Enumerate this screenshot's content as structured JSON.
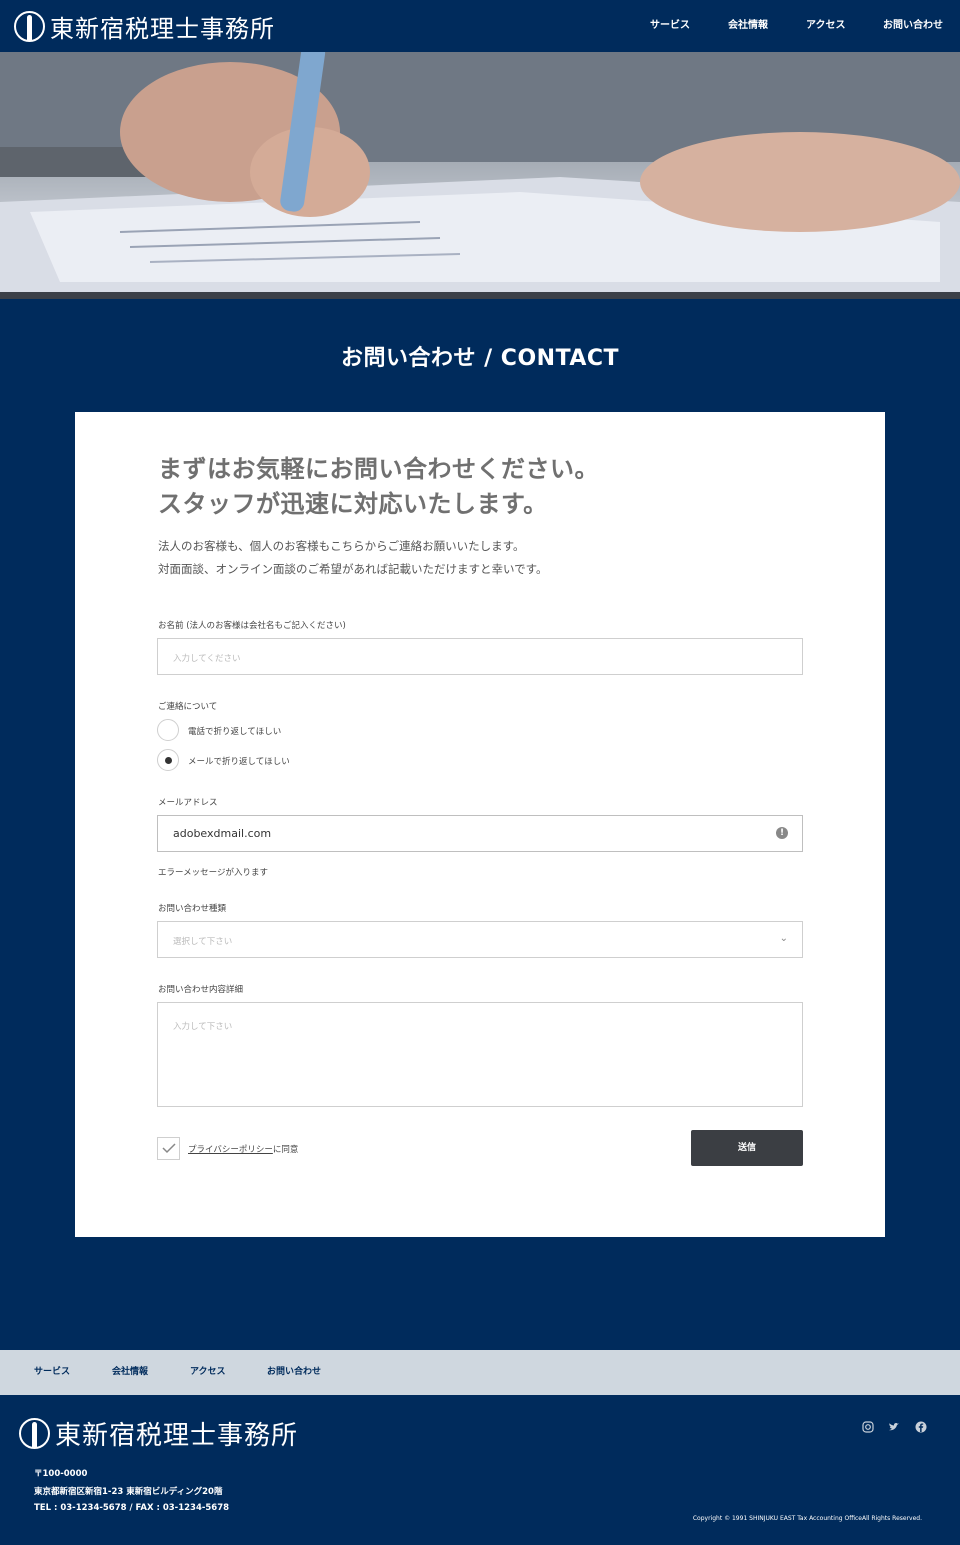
{
  "header": {
    "logo_text": "東新宿税理士事務所",
    "nav": [
      "サービス",
      "会社情報",
      "アクセス",
      "お問い合わせ"
    ]
  },
  "section_title": "お問い合わせ / CONTACT",
  "form": {
    "lead_line1": "まずはお気軽にお問い合わせください。",
    "lead_line2": "スタッフが迅速に対応いたします。",
    "desc_line1": "法人のお客様も、個人のお客様もこちらからご連絡お願いいたします。",
    "desc_line2": "対面面談、オンライン面談のご希望があれば記載いただけますと幸いです。",
    "name_label": "お名前 (法人のお客様は会社名もご記入ください)",
    "name_placeholder": "入力してください",
    "contact_label": "ご連絡について",
    "radio_phone": "電話で折り返してほしい",
    "radio_mail": "メールで折り返してほしい",
    "email_label": "メールアドレス",
    "email_value": "adobexdmail.com",
    "email_error": "エラーメッセージが入ります",
    "type_label": "お問い合わせ種類",
    "type_placeholder": "選択して下さい",
    "detail_label": "お問い合わせ内容詳細",
    "detail_placeholder": "入力して下さい",
    "privacy_link": "プライバシーポリシー",
    "privacy_suffix": "に同意",
    "submit_label": "送信"
  },
  "footer": {
    "nav": [
      "サービス",
      "会社情報",
      "アクセス",
      "お問い合わせ"
    ],
    "logo_text": "東新宿税理士事務所",
    "postal": "〒100-0000",
    "address": "東京都新宿区新宿1-23 東新宿ビルディング20階",
    "tel": "TEL : 03-1234-5678 / FAX : 03-1234-5678",
    "copyright": "Copyright © 1991 SHINJUKU EAST Tax Accounting OfficeAll Rights Reserved."
  },
  "icons": [
    "instagram-icon",
    "twitter-icon",
    "facebook-icon"
  ],
  "colors": {
    "navy": "#002b5c",
    "footer_nav_bg": "#cfd7df",
    "button": "#3b3e43"
  }
}
